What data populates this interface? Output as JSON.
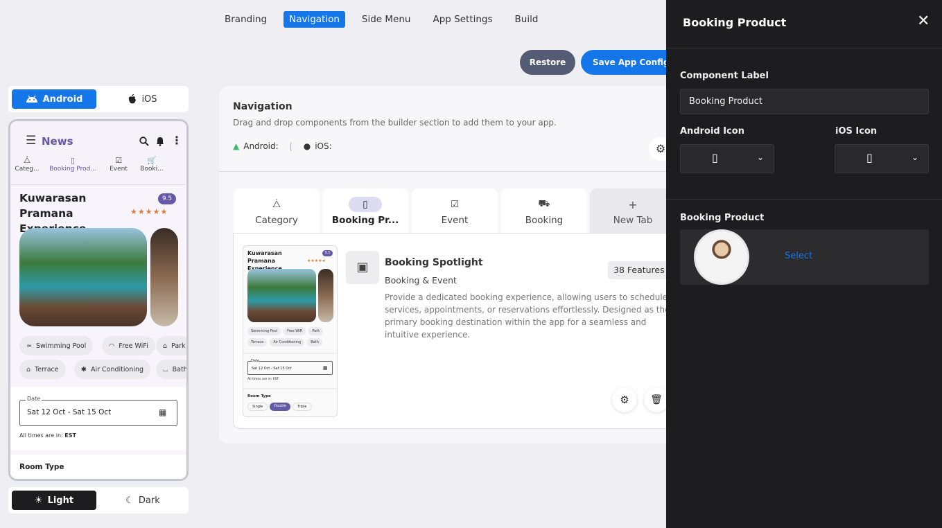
{
  "top_tabs": {
    "branding": "Branding",
    "navigation": "Navigation",
    "side_menu": "Side Menu",
    "app_settings": "App Settings",
    "build": "Build"
  },
  "actions": {
    "restore": "Restore",
    "save": "Save App Config"
  },
  "platform": {
    "android": "Android",
    "ios": "iOS"
  },
  "theme": {
    "light": "Light",
    "dark": "Dark"
  },
  "phone": {
    "title": "News",
    "tabs": [
      "Categ...",
      "Booking Prod...",
      "Event",
      "Booki..."
    ],
    "hotel_name": "Kuwarasan Pramana Experience",
    "score": "9.5",
    "amenities": [
      "Swimming Pool",
      "Free WiFi",
      "Park",
      "Terrace",
      "Air Conditioning",
      "Bath"
    ],
    "date_label": "Date",
    "date_value": "Sat 12 Oct - Sat 15 Oct",
    "tz_prefix": "All times are in: ",
    "tz": "EST",
    "room_type": "Room Type"
  },
  "nav": {
    "title": "Navigation",
    "desc": "Drag and drop components from the builder section to add them to your app.",
    "android_label": "Android:",
    "ios_label": "iOS:",
    "tabs": [
      "Category",
      "Booking Pr...",
      "Event",
      "Booking",
      "New Tab"
    ]
  },
  "mini": {
    "hotel_name": "Kuwarasan Pramana Experience",
    "score": "9.5",
    "amenities": [
      "Swimming Pool",
      "Free WiFi",
      "Park",
      "Terrace",
      "Air Conditioning",
      "Bath"
    ],
    "date_label": "Date",
    "date_value": "Sat 12 Oct - Sat 15 Oct",
    "tz": "All times are in: EST",
    "room_type": "Room Type",
    "rooms": [
      "Single",
      "Double",
      "Triple"
    ]
  },
  "component": {
    "title": "Booking Spotlight",
    "category": "Booking & Event",
    "features": "38 Features",
    "desc": "Provide a dedicated booking experience, allowing users to schedule services, appointments, or reservations effortlessly. Designed as the primary booking destination within the app for a seamless and intuitive experience."
  },
  "panel": {
    "title": "Booking Product",
    "label_heading": "Component Label",
    "label_value": "Booking Product",
    "android_icon": "Android Icon",
    "ios_icon": "iOS Icon",
    "section": "Booking Product",
    "select": "Select"
  },
  "colors": {
    "accent": "#1476e9",
    "purple": "#6459a8",
    "panel": "#1d1d1f"
  }
}
